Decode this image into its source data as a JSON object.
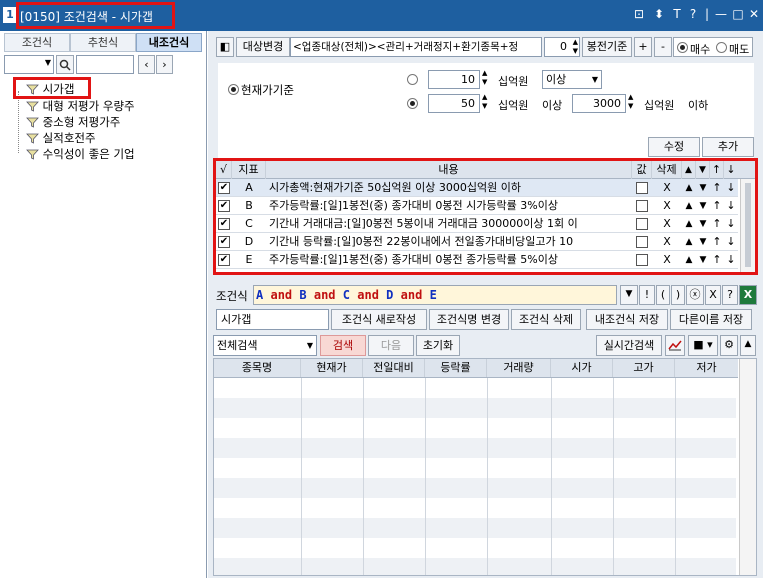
{
  "window": {
    "icon_text": "1",
    "title": "[0150] 조건검색 - 시가갭",
    "controls": [
      "⊡",
      "⬍",
      "T",
      "?",
      "|",
      "—",
      "□",
      "✕"
    ]
  },
  "left": {
    "tabs": [
      {
        "label": "조건식"
      },
      {
        "label": "추천식"
      },
      {
        "label": "내조건식"
      }
    ],
    "tree": [
      {
        "label": "시가갭"
      },
      {
        "label": "대형 저평가 우량주"
      },
      {
        "label": "중소형 저평가주"
      },
      {
        "label": "실적호전주"
      },
      {
        "label": "수익성이 좋은 기업"
      }
    ]
  },
  "top": {
    "target_button": "대상변경",
    "target_text": "<업종대상(전체)><관리+거래정지+환기종목+정",
    "spin_value": "0",
    "base_label": "봉전기준",
    "plus": "+",
    "minus": "-",
    "buy_label": "매수",
    "sell_label": "매도"
  },
  "criteria": {
    "base_label": "현재가기준",
    "row1": {
      "value": "10",
      "unit": "십억원",
      "cond": "이상"
    },
    "row2": {
      "value": "50",
      "unit": "십억원",
      "cond": "이상",
      "value2": "3000",
      "unit2": "십억원",
      "cond2": "이하"
    },
    "modify": "수정",
    "add": "추가"
  },
  "cond_table": {
    "headers": {
      "check": "√",
      "index": "지표",
      "content": "내용",
      "value": "값",
      "delete": "삭제"
    },
    "rows": [
      {
        "key": "A",
        "text": "시가총액:현재가기준 50십억원 이상 3000십억원 이하"
      },
      {
        "key": "B",
        "text": "주가등락률:[일]1봉전(중) 종가대비 0봉전 시가등락률 3%이상"
      },
      {
        "key": "C",
        "text": "기간내 거래대금:[일]0봉전 5봉이내 거래대금 300000이상 1회 이"
      },
      {
        "key": "D",
        "text": "기간내 등락률:[일]0봉전 22봉이내에서 전일종가대비당일고가 10"
      },
      {
        "key": "E",
        "text": "주가등락률:[일]1봉전(중) 종가대비 0봉전 종가등락률 5%이상"
      }
    ],
    "delete_mark": "X"
  },
  "expr": {
    "label": "조건식",
    "tokens": [
      "A",
      "and",
      "B",
      "and",
      "C",
      "and",
      "D",
      "and",
      "E"
    ],
    "buttons": [
      "▼",
      "!",
      "(",
      ")",
      "ⓧ",
      "X",
      "?"
    ]
  },
  "actions": {
    "name_value": "시가갭",
    "new": "조건식 새로작성",
    "rename": "조건식명 변경",
    "delete": "조건식 삭제",
    "save": "내조건식 저장",
    "save_as": "다른이름 저장"
  },
  "search": {
    "scope": "전체검색",
    "search": "검색",
    "next": "다음",
    "reset": "초기화",
    "realtime": "실시간검색"
  },
  "results": {
    "headers": [
      "종목명",
      "현재가",
      "전일대비",
      "등락률",
      "거래량",
      "시가",
      "고가",
      "저가"
    ]
  },
  "colors": {
    "title_bar": "#1e5fa0",
    "highlight": "#e11414",
    "expr_blue": "#1030c0",
    "expr_red": "#c01010"
  }
}
